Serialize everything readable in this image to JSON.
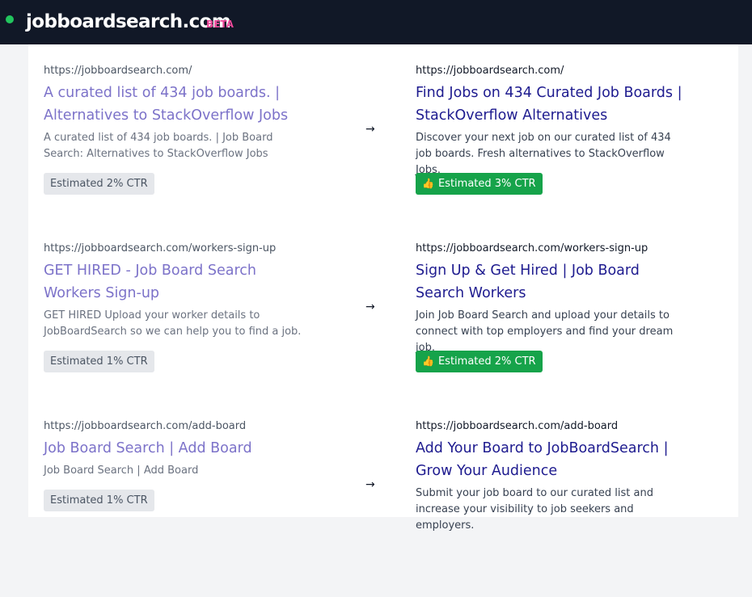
{
  "header": {
    "brand": "jobboardsearch.com",
    "badge": "BETA"
  },
  "comparisons": [
    {
      "before": {
        "url": "https://jobboardsearch.com/",
        "title": "A curated list of 434 job boards. | Alternatives to StackOverflow Jobs",
        "description": "A curated list of 434 job boards. | Job Board Search: Alternatives to StackOverflow Jobs",
        "ctr_label": "Estimated 2% CTR"
      },
      "arrow": "→",
      "after": {
        "url": "https://jobboardsearch.com/",
        "title": "Find Jobs on 434 Curated Job Boards | StackOverflow Alternatives",
        "description": "Discover your next job on our curated list of 434 job boards. Fresh alternatives to StackOverflow Jobs.",
        "ctr_icon": "👍",
        "ctr_label": "Estimated 3% CTR"
      }
    },
    {
      "before": {
        "url": "https://jobboardsearch.com/workers-sign-up",
        "title": "GET HIRED - Job Board Search Workers Sign-up",
        "description": "GET HIRED Upload your worker details to JobBoardSearch so we can help you to find a job.",
        "ctr_label": "Estimated 1% CTR"
      },
      "arrow": "→",
      "after": {
        "url": "https://jobboardsearch.com/workers-sign-up",
        "title": "Sign Up & Get Hired | Job Board Search Workers",
        "description": "Join Job Board Search and upload your details to connect with top employers and find your dream job.",
        "ctr_icon": "👍",
        "ctr_label": "Estimated 2% CTR"
      }
    },
    {
      "before": {
        "url": "https://jobboardsearch.com/add-board",
        "title": "Job Board Search | Add Board",
        "description": "Job Board Search | Add Board",
        "ctr_label": "Estimated 1% CTR"
      },
      "arrow": "→",
      "after": {
        "url": "https://jobboardsearch.com/add-board",
        "title": "Add Your Board to JobBoardSearch | Grow Your Audience",
        "description": "Submit your job board to our curated list and increase your visibility to job seekers and employers."
      }
    }
  ],
  "colors": {
    "header_bg": "#111827",
    "status_dot": "#22c55e",
    "beta": "#ec4899",
    "old_title": "#7c72c9",
    "new_title": "#1e1b8f",
    "good_badge": "#16a34a"
  }
}
